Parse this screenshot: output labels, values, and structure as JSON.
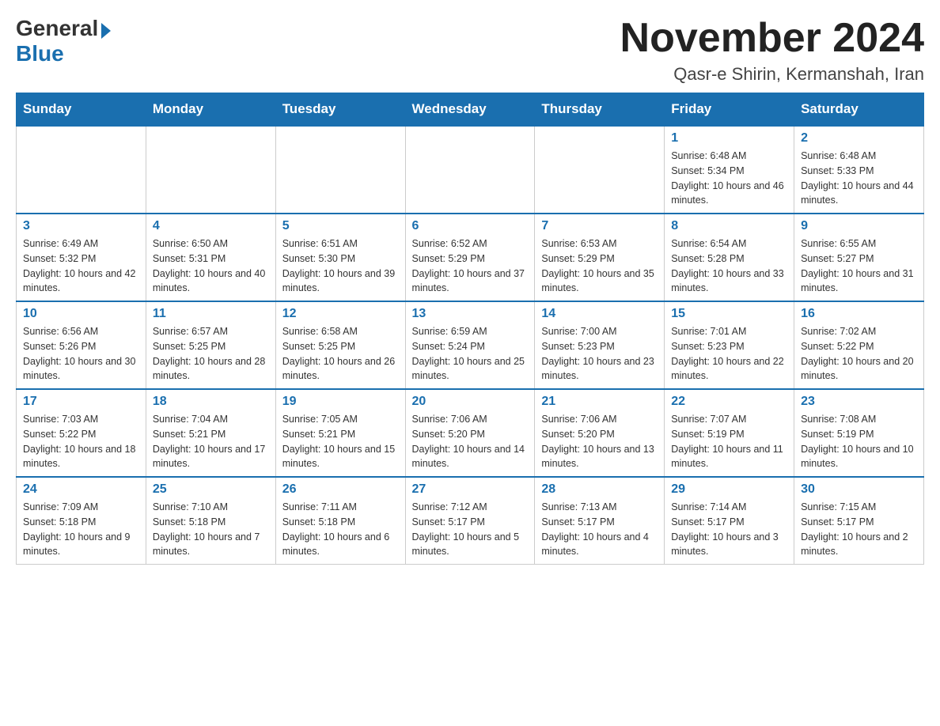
{
  "header": {
    "logo_general": "General",
    "logo_blue": "Blue",
    "month_title": "November 2024",
    "location": "Qasr-e Shirin, Kermanshah, Iran"
  },
  "weekdays": [
    "Sunday",
    "Monday",
    "Tuesday",
    "Wednesday",
    "Thursday",
    "Friday",
    "Saturday"
  ],
  "weeks": [
    [
      {
        "day": "",
        "info": ""
      },
      {
        "day": "",
        "info": ""
      },
      {
        "day": "",
        "info": ""
      },
      {
        "day": "",
        "info": ""
      },
      {
        "day": "",
        "info": ""
      },
      {
        "day": "1",
        "info": "Sunrise: 6:48 AM\nSunset: 5:34 PM\nDaylight: 10 hours and 46 minutes."
      },
      {
        "day": "2",
        "info": "Sunrise: 6:48 AM\nSunset: 5:33 PM\nDaylight: 10 hours and 44 minutes."
      }
    ],
    [
      {
        "day": "3",
        "info": "Sunrise: 6:49 AM\nSunset: 5:32 PM\nDaylight: 10 hours and 42 minutes."
      },
      {
        "day": "4",
        "info": "Sunrise: 6:50 AM\nSunset: 5:31 PM\nDaylight: 10 hours and 40 minutes."
      },
      {
        "day": "5",
        "info": "Sunrise: 6:51 AM\nSunset: 5:30 PM\nDaylight: 10 hours and 39 minutes."
      },
      {
        "day": "6",
        "info": "Sunrise: 6:52 AM\nSunset: 5:29 PM\nDaylight: 10 hours and 37 minutes."
      },
      {
        "day": "7",
        "info": "Sunrise: 6:53 AM\nSunset: 5:29 PM\nDaylight: 10 hours and 35 minutes."
      },
      {
        "day": "8",
        "info": "Sunrise: 6:54 AM\nSunset: 5:28 PM\nDaylight: 10 hours and 33 minutes."
      },
      {
        "day": "9",
        "info": "Sunrise: 6:55 AM\nSunset: 5:27 PM\nDaylight: 10 hours and 31 minutes."
      }
    ],
    [
      {
        "day": "10",
        "info": "Sunrise: 6:56 AM\nSunset: 5:26 PM\nDaylight: 10 hours and 30 minutes."
      },
      {
        "day": "11",
        "info": "Sunrise: 6:57 AM\nSunset: 5:25 PM\nDaylight: 10 hours and 28 minutes."
      },
      {
        "day": "12",
        "info": "Sunrise: 6:58 AM\nSunset: 5:25 PM\nDaylight: 10 hours and 26 minutes."
      },
      {
        "day": "13",
        "info": "Sunrise: 6:59 AM\nSunset: 5:24 PM\nDaylight: 10 hours and 25 minutes."
      },
      {
        "day": "14",
        "info": "Sunrise: 7:00 AM\nSunset: 5:23 PM\nDaylight: 10 hours and 23 minutes."
      },
      {
        "day": "15",
        "info": "Sunrise: 7:01 AM\nSunset: 5:23 PM\nDaylight: 10 hours and 22 minutes."
      },
      {
        "day": "16",
        "info": "Sunrise: 7:02 AM\nSunset: 5:22 PM\nDaylight: 10 hours and 20 minutes."
      }
    ],
    [
      {
        "day": "17",
        "info": "Sunrise: 7:03 AM\nSunset: 5:22 PM\nDaylight: 10 hours and 18 minutes."
      },
      {
        "day": "18",
        "info": "Sunrise: 7:04 AM\nSunset: 5:21 PM\nDaylight: 10 hours and 17 minutes."
      },
      {
        "day": "19",
        "info": "Sunrise: 7:05 AM\nSunset: 5:21 PM\nDaylight: 10 hours and 15 minutes."
      },
      {
        "day": "20",
        "info": "Sunrise: 7:06 AM\nSunset: 5:20 PM\nDaylight: 10 hours and 14 minutes."
      },
      {
        "day": "21",
        "info": "Sunrise: 7:06 AM\nSunset: 5:20 PM\nDaylight: 10 hours and 13 minutes."
      },
      {
        "day": "22",
        "info": "Sunrise: 7:07 AM\nSunset: 5:19 PM\nDaylight: 10 hours and 11 minutes."
      },
      {
        "day": "23",
        "info": "Sunrise: 7:08 AM\nSunset: 5:19 PM\nDaylight: 10 hours and 10 minutes."
      }
    ],
    [
      {
        "day": "24",
        "info": "Sunrise: 7:09 AM\nSunset: 5:18 PM\nDaylight: 10 hours and 9 minutes."
      },
      {
        "day": "25",
        "info": "Sunrise: 7:10 AM\nSunset: 5:18 PM\nDaylight: 10 hours and 7 minutes."
      },
      {
        "day": "26",
        "info": "Sunrise: 7:11 AM\nSunset: 5:18 PM\nDaylight: 10 hours and 6 minutes."
      },
      {
        "day": "27",
        "info": "Sunrise: 7:12 AM\nSunset: 5:17 PM\nDaylight: 10 hours and 5 minutes."
      },
      {
        "day": "28",
        "info": "Sunrise: 7:13 AM\nSunset: 5:17 PM\nDaylight: 10 hours and 4 minutes."
      },
      {
        "day": "29",
        "info": "Sunrise: 7:14 AM\nSunset: 5:17 PM\nDaylight: 10 hours and 3 minutes."
      },
      {
        "day": "30",
        "info": "Sunrise: 7:15 AM\nSunset: 5:17 PM\nDaylight: 10 hours and 2 minutes."
      }
    ]
  ]
}
